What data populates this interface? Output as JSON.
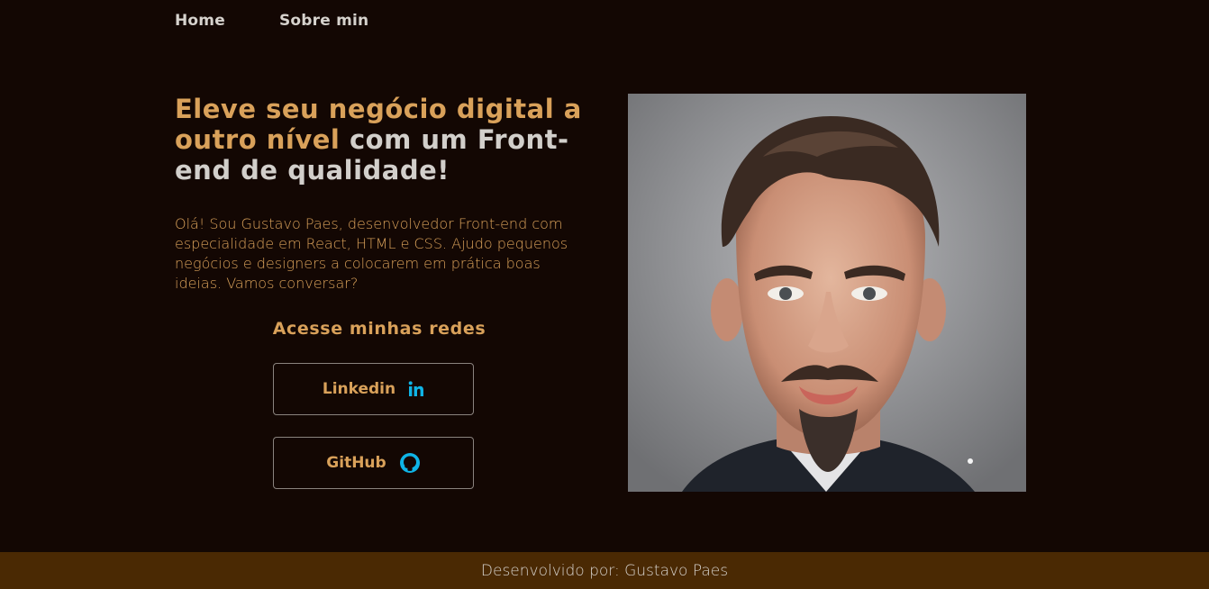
{
  "nav": {
    "items": [
      {
        "label": "Home"
      },
      {
        "label": "Sobre min"
      }
    ]
  },
  "hero": {
    "headline_accent": "Eleve seu negócio digital a outro nível",
    "headline_light": "com um Front-end de qualidade!",
    "intro": "Olá! Sou Gustavo Paes, desenvolvedor Front-end com especialidade em React, HTML e CSS. Ajudo pequenos negócios e designers a colocarem em prática boas ideias. Vamos conversar?",
    "networks_title": "Acesse minhas redes",
    "buttons": [
      {
        "label": "Linkedin",
        "icon": "linkedin-icon"
      },
      {
        "label": "GitHub",
        "icon": "github-icon"
      }
    ]
  },
  "footer": {
    "text": "Desenvolvido por: Gustavo Paes"
  },
  "colors": {
    "background": "#130703",
    "accent": "#d9a15a",
    "light_text": "#d2cfcb",
    "icon_blue": "#0fb4e6",
    "footer_bg": "#4a2903"
  }
}
